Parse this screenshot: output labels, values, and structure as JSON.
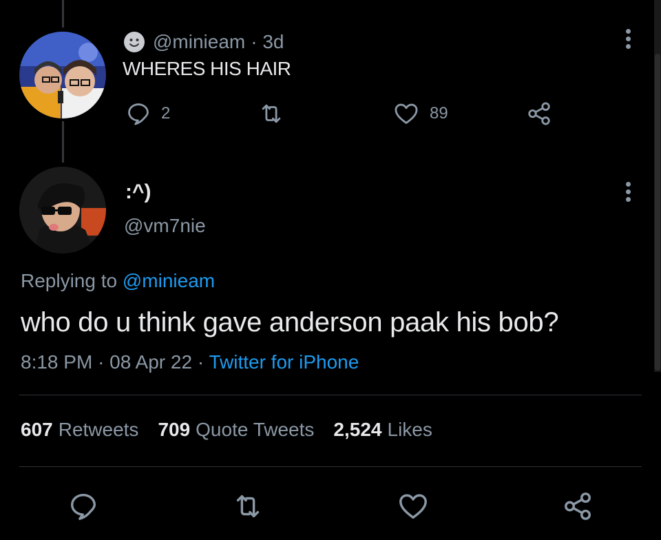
{
  "parent_tweet": {
    "handle": "@minieam",
    "time": "· 3d",
    "text": "WHERES HIS HAIR",
    "reply_count": "2",
    "like_count": "89"
  },
  "reply_tweet": {
    "display_name": ":^)",
    "handle": "@vm7nie",
    "replying_prefix": "Replying to",
    "replying_mention": "@minieam",
    "text": "who do u think gave anderson paak his bob?",
    "time": "8:18 PM",
    "date": "08 Apr 22",
    "source": "Twitter for iPhone"
  },
  "stats": [
    {
      "number": "607",
      "label": "Retweets"
    },
    {
      "number": "709",
      "label": "Quote Tweets"
    },
    {
      "number": "2,524",
      "label": "Likes"
    }
  ],
  "icons": {
    "reply": "reply-icon",
    "retweet": "retweet-icon",
    "like": "heart-icon",
    "share": "share-icon",
    "more": "more-icon",
    "emoji": "smiley-face-icon"
  },
  "colors": {
    "background": "#000000",
    "text": "#e7e9ea",
    "secondary": "#8b98a5",
    "accent": "#1d9bf0",
    "divider": "#2f3336"
  }
}
